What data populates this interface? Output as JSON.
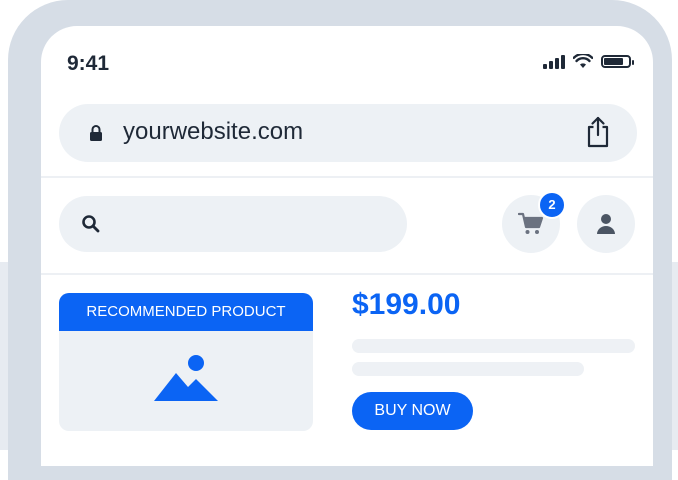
{
  "status_bar": {
    "time": "9:41",
    "battery_level": 0.8
  },
  "browser": {
    "url": "yourwebsite.com"
  },
  "header": {
    "search_placeholder": "",
    "cart_count": "2"
  },
  "product": {
    "label": "RECOMMENDED PRODUCT",
    "price": "$199.00",
    "buy_label": "BUY NOW"
  },
  "colors": {
    "accent": "#0b64f4",
    "frame": "#d6dde6",
    "surface": "#edf1f5",
    "text": "#1f2937"
  },
  "icons": [
    "lock-icon",
    "share-icon",
    "search-icon",
    "cart-icon",
    "user-icon",
    "image-placeholder-icon",
    "signal-icon",
    "wifi-icon",
    "battery-icon"
  ]
}
